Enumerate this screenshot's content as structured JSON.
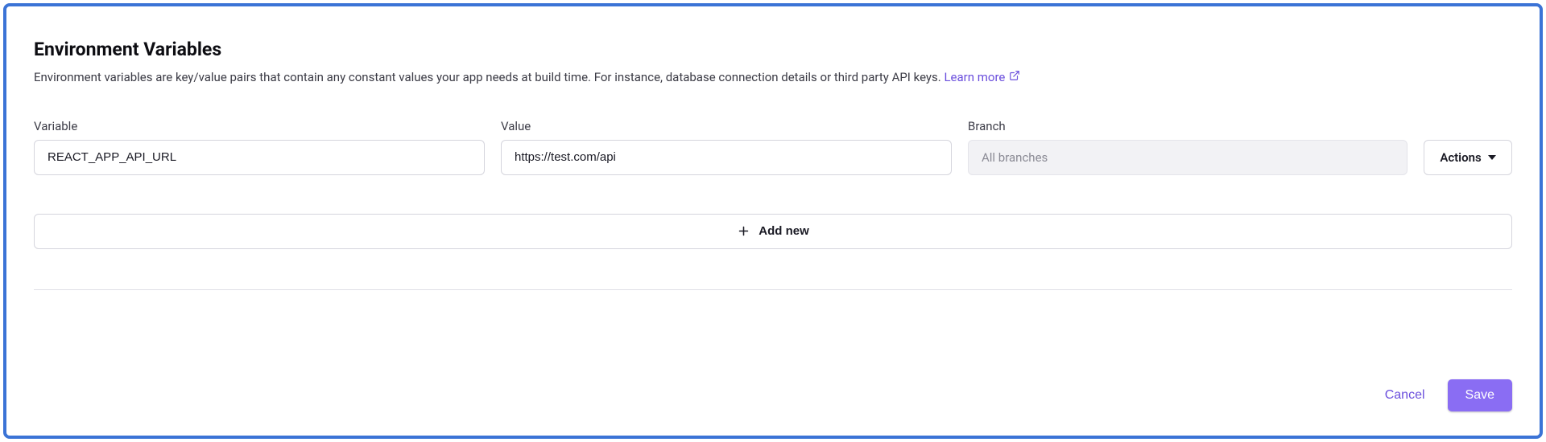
{
  "section": {
    "title": "Environment Variables",
    "description": "Environment variables are key/value pairs that contain any constant values your app needs at build time. For instance, database connection details or third party API keys.",
    "learn_more_label": "Learn more"
  },
  "fields": {
    "variable_label": "Variable",
    "value_label": "Value",
    "branch_label": "Branch"
  },
  "row": {
    "variable_value": "REACT_APP_API_URL",
    "value_value": "https://test.com/api",
    "branch_selected": "All branches"
  },
  "actions": {
    "menu_label": "Actions",
    "add_new_label": "Add new"
  },
  "footer": {
    "cancel_label": "Cancel",
    "save_label": "Save"
  }
}
